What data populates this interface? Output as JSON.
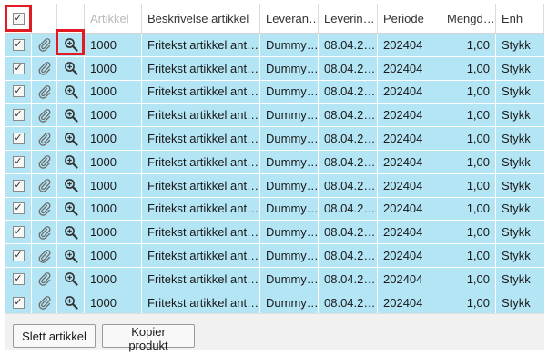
{
  "columns": [
    {
      "key": "select",
      "label": ""
    },
    {
      "key": "attachment",
      "label": ""
    },
    {
      "key": "details",
      "label": ""
    },
    {
      "key": "artikkel",
      "label": "Artikkel"
    },
    {
      "key": "beskrivelse",
      "label": "Beskrivelse artikkel"
    },
    {
      "key": "leverandor",
      "label": "Leveran…"
    },
    {
      "key": "leveringsdato",
      "label": "Leverin…"
    },
    {
      "key": "periode",
      "label": "Periode"
    },
    {
      "key": "mengde",
      "label": "Mengd…"
    },
    {
      "key": "enhet",
      "label": "Enh"
    }
  ],
  "header_select_checked": "✓",
  "rows": [
    {
      "checked": "✓",
      "artikkel": "1000",
      "beskrivelse": "Fritekst artikkel ant…",
      "leverandor": "Dummy…",
      "leveringsdato": "08.04.2…",
      "periode": "202404",
      "mengde": "1,00",
      "enhet": "Stykk"
    },
    {
      "checked": "✓",
      "artikkel": "1000",
      "beskrivelse": "Fritekst artikkel ant…",
      "leverandor": "Dummy…",
      "leveringsdato": "08.04.2…",
      "periode": "202404",
      "mengde": "1,00",
      "enhet": "Stykk"
    },
    {
      "checked": "✓",
      "artikkel": "1000",
      "beskrivelse": "Fritekst artikkel ant…",
      "leverandor": "Dummy…",
      "leveringsdato": "08.04.2…",
      "periode": "202404",
      "mengde": "1,00",
      "enhet": "Stykk"
    },
    {
      "checked": "✓",
      "artikkel": "1000",
      "beskrivelse": "Fritekst artikkel ant…",
      "leverandor": "Dummy…",
      "leveringsdato": "08.04.2…",
      "periode": "202404",
      "mengde": "1,00",
      "enhet": "Stykk"
    },
    {
      "checked": "✓",
      "artikkel": "1000",
      "beskrivelse": "Fritekst artikkel ant…",
      "leverandor": "Dummy…",
      "leveringsdato": "08.04.2…",
      "periode": "202404",
      "mengde": "1,00",
      "enhet": "Stykk"
    },
    {
      "checked": "✓",
      "artikkel": "1000",
      "beskrivelse": "Fritekst artikkel ant…",
      "leverandor": "Dummy…",
      "leveringsdato": "08.04.2…",
      "periode": "202404",
      "mengde": "1,00",
      "enhet": "Stykk"
    },
    {
      "checked": "✓",
      "artikkel": "1000",
      "beskrivelse": "Fritekst artikkel ant…",
      "leverandor": "Dummy…",
      "leveringsdato": "08.04.2…",
      "periode": "202404",
      "mengde": "1,00",
      "enhet": "Stykk"
    },
    {
      "checked": "✓",
      "artikkel": "1000",
      "beskrivelse": "Fritekst artikkel ant…",
      "leverandor": "Dummy…",
      "leveringsdato": "08.04.2…",
      "periode": "202404",
      "mengde": "1,00",
      "enhet": "Stykk"
    },
    {
      "checked": "✓",
      "artikkel": "1000",
      "beskrivelse": "Fritekst artikkel ant…",
      "leverandor": "Dummy…",
      "leveringsdato": "08.04.2…",
      "periode": "202404",
      "mengde": "1,00",
      "enhet": "Stykk"
    },
    {
      "checked": "✓",
      "artikkel": "1000",
      "beskrivelse": "Fritekst artikkel ant…",
      "leverandor": "Dummy…",
      "leveringsdato": "08.04.2…",
      "periode": "202404",
      "mengde": "1,00",
      "enhet": "Stykk"
    },
    {
      "checked": "✓",
      "artikkel": "1000",
      "beskrivelse": "Fritekst artikkel ant…",
      "leverandor": "Dummy…",
      "leveringsdato": "08.04.2…",
      "periode": "202404",
      "mengde": "1,00",
      "enhet": "Stykk"
    },
    {
      "checked": "✓",
      "artikkel": "1000",
      "beskrivelse": "Fritekst artikkel ant…",
      "leverandor": "Dummy…",
      "leveringsdato": "08.04.2…",
      "periode": "202404",
      "mengde": "1,00",
      "enhet": "Stykk"
    }
  ],
  "icons": {
    "attachment": "paperclip-icon",
    "details": "zoom-in-icon"
  },
  "colors": {
    "row_selected": "#b3e5f5",
    "highlight": "#e21b23"
  },
  "toolbar": {
    "delete_label": "Slett artikkel",
    "copy_label": "Kopier produkt"
  }
}
